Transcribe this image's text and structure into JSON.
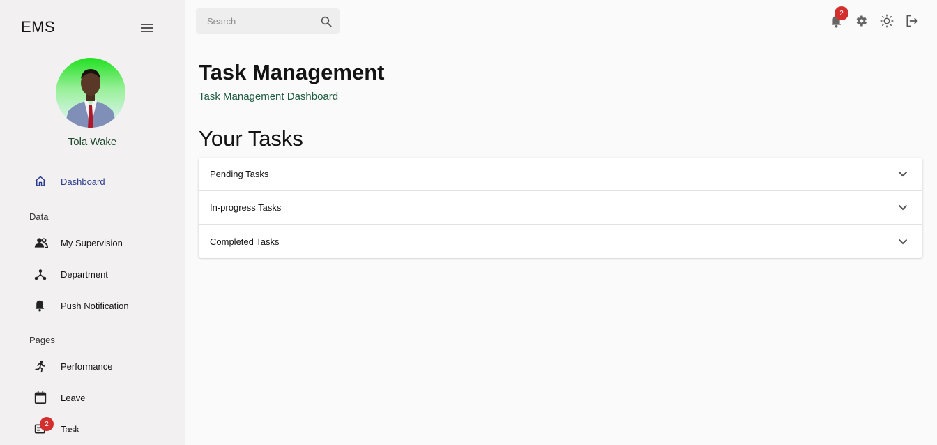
{
  "app": {
    "brand": "EMS"
  },
  "user": {
    "name": "Tola Wake"
  },
  "sidebar": {
    "dashboard": {
      "label": "Dashboard",
      "icon": "home-icon"
    },
    "data_section": "Data",
    "data_items": [
      {
        "label": "My Supervision",
        "icon": "people-icon"
      },
      {
        "label": "Department",
        "icon": "hub-icon"
      },
      {
        "label": "Push Notification",
        "icon": "bell-icon"
      }
    ],
    "pages_section": "Pages",
    "page_items": [
      {
        "label": "Performance",
        "icon": "running-icon"
      },
      {
        "label": "Leave",
        "icon": "calendar-icon"
      },
      {
        "label": "Task",
        "icon": "task-icon",
        "badge": "2"
      }
    ]
  },
  "search": {
    "placeholder": "Search",
    "value": ""
  },
  "topbar": {
    "notification_count": "2"
  },
  "main": {
    "title": "Task Management",
    "subtitle": "Task Management Dashboard",
    "section_title": "Your Tasks",
    "accordion": [
      {
        "label": "Pending Tasks"
      },
      {
        "label": "In-progress Tasks"
      },
      {
        "label": "Completed Tasks"
      }
    ]
  },
  "colors": {
    "sidebar_bg": "#f2f0f0",
    "active_nav": "#2a3a8c",
    "badge": "#d32f2f",
    "subtitle": "#1e5a40"
  }
}
